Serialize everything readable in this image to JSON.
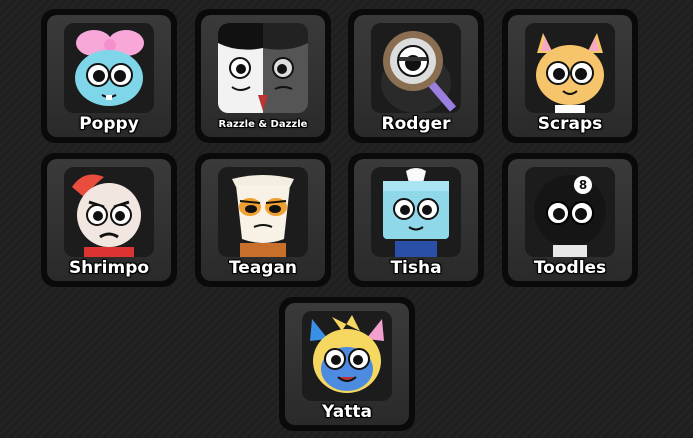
{
  "characters": [
    {
      "name": "Poppy",
      "icon": "poppy-portrait-icon"
    },
    {
      "name": "Razzle & Dazzle",
      "icon": "razzle-dazzle-portrait-icon"
    },
    {
      "name": "Rodger",
      "icon": "rodger-portrait-icon"
    },
    {
      "name": "Scraps",
      "icon": "scraps-portrait-icon"
    },
    {
      "name": "Shrimpo",
      "icon": "shrimpo-portrait-icon"
    },
    {
      "name": "Teagan",
      "icon": "teagan-portrait-icon"
    },
    {
      "name": "Tisha",
      "icon": "tisha-portrait-icon"
    },
    {
      "name": "Toodles",
      "icon": "toodles-portrait-icon"
    },
    {
      "name": "Yatta",
      "icon": "yatta-portrait-icon"
    }
  ],
  "colors": {
    "card_border": "#0a0a0a",
    "card_fill": "#2f2f2f",
    "label": "#ffffff",
    "background": "#222222"
  }
}
